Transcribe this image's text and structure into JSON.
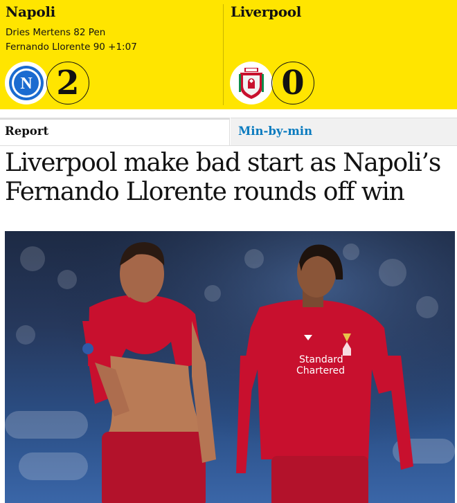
{
  "match": {
    "home": {
      "name": "Napoli",
      "scorers": [
        "Dries Mertens 82 Pen",
        "Fernando Llorente 90 +1:07"
      ],
      "score": "2",
      "badge_icon": "napoli-crest-icon",
      "badge_letter": "N"
    },
    "away": {
      "name": "Liverpool",
      "scorers": [],
      "score": "0",
      "badge_icon": "liverpool-crest-icon"
    }
  },
  "tabs": [
    {
      "label": "Report",
      "active": true
    },
    {
      "label": "Min-by-min",
      "active": false
    }
  ],
  "article": {
    "headline": "Liverpool make bad start as Napoli’s Fernando Llorente rounds off win"
  },
  "photo": {
    "shirt_sponsor": [
      "Standard",
      "Chartered"
    ]
  },
  "colors": {
    "scoreboard_bg": "#ffe500",
    "link_blue": "#0a7bbf",
    "text": "#121212",
    "liverpool_red": "#c8102e",
    "napoli_blue": "#1b6bd0"
  }
}
